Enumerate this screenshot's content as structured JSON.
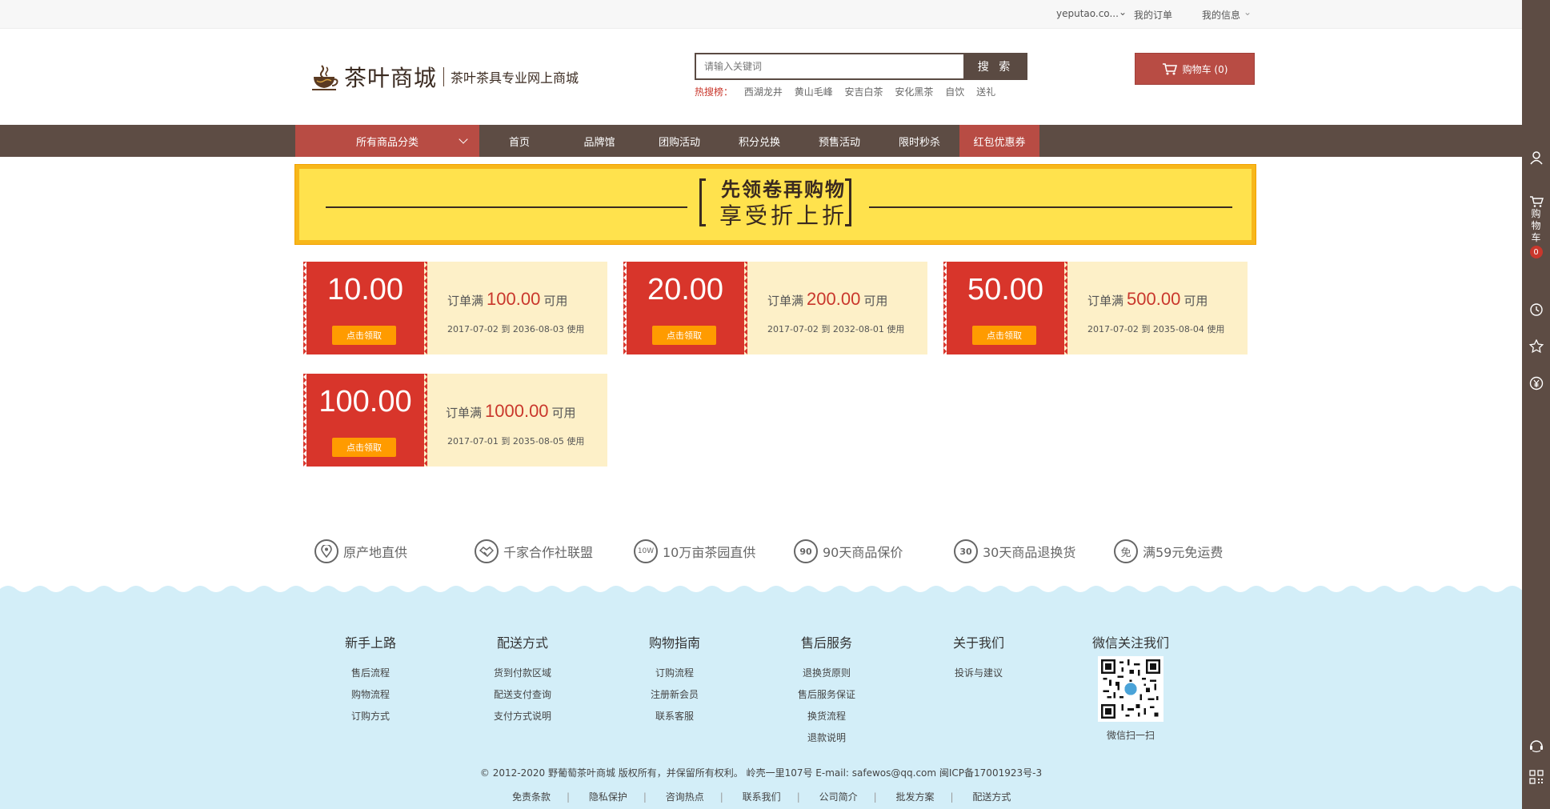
{
  "topbar": {
    "user": "yeputao.co...",
    "orders": "我的订单",
    "info": "我的信息"
  },
  "logo": {
    "name": "茶叶商城",
    "slogan": "茶叶茶具专业网上商城"
  },
  "search": {
    "placeholder": "请输入关键词",
    "button": "搜 索"
  },
  "hot": {
    "label": "热搜榜：",
    "keywords": [
      "西湖龙井",
      "黄山毛峰",
      "安吉白茶",
      "安化黑茶",
      "自饮",
      "送礼"
    ]
  },
  "cart": {
    "label": "购物车 (0)"
  },
  "nav": {
    "all": "所有商品分类",
    "items": [
      "首页",
      "品牌馆",
      "团购活动",
      "积分兑换",
      "预售活动",
      "限时秒杀",
      "红包优惠券"
    ]
  },
  "banner": {
    "line1": "先领卷再购物",
    "line2": "享受折上折"
  },
  "coupons": [
    {
      "amount": "10.00",
      "cond_pre": "订单满",
      "min": "100.00",
      "cond_post": "可用",
      "date": "2017-07-02 到 2036-08-03 使用",
      "button": "点击领取"
    },
    {
      "amount": "20.00",
      "cond_pre": "订单满",
      "min": "200.00",
      "cond_post": "可用",
      "date": "2017-07-02 到 2032-08-01 使用",
      "button": "点击领取"
    },
    {
      "amount": "50.00",
      "cond_pre": "订单满",
      "min": "500.00",
      "cond_post": "可用",
      "date": "2017-07-02 到 2035-08-04 使用",
      "button": "点击领取"
    },
    {
      "amount": "100.00",
      "cond_pre": "订单满",
      "min": "1000.00",
      "cond_post": "可用",
      "date": "2017-07-01 到 2035-08-05 使用",
      "button": "点击领取"
    }
  ],
  "services": [
    {
      "icon": "location-icon",
      "label": "原产地直供"
    },
    {
      "icon": "handshake-icon",
      "label": "千家合作社联盟"
    },
    {
      "icon": "10w-icon",
      "glyph": "10W",
      "label": "10万亩茶园直供"
    },
    {
      "icon": "90-icon",
      "glyph": "90",
      "label": "90天商品保价"
    },
    {
      "icon": "30-icon",
      "glyph": "30",
      "label": "30天商品退换货"
    },
    {
      "icon": "free-icon",
      "glyph": "免",
      "label": "满59元免运费"
    }
  ],
  "footer": {
    "cols": [
      {
        "title": "新手上路",
        "links": [
          "售后流程",
          "购物流程",
          "订购方式"
        ]
      },
      {
        "title": "配送方式",
        "links": [
          "货到付款区域",
          "配送支付查询",
          "支付方式说明"
        ]
      },
      {
        "title": "购物指南",
        "links": [
          "订购流程",
          "注册新会员",
          "联系客服"
        ]
      },
      {
        "title": "售后服务",
        "links": [
          "退换货原则",
          "售后服务保证",
          "换货流程",
          "退款说明"
        ]
      },
      {
        "title": "关于我们",
        "links": [
          "投诉与建议"
        ]
      }
    ],
    "wechat": {
      "title": "微信关注我们",
      "caption": "微信扫一扫"
    },
    "copyright": "© 2012-2020 野葡萄茶叶商城 版权所有，并保留所有权利。 岭壳一里107号 E-mail: safewos@qq.com 闽ICP备17001923号-3",
    "links": [
      "免责条款",
      "隐私保护",
      "咨询热点",
      "联系我们",
      "公司简介",
      "批发方案",
      "配送方式"
    ]
  },
  "sidebar": {
    "cart_label": "购物车",
    "cart_count": "0"
  },
  "colors": {
    "brown": "#5d4c44",
    "red": "#b84c44",
    "coupon_red": "#d8352b",
    "banner_yellow": "#ffe24d",
    "footer_blue": "#d3eef8"
  }
}
